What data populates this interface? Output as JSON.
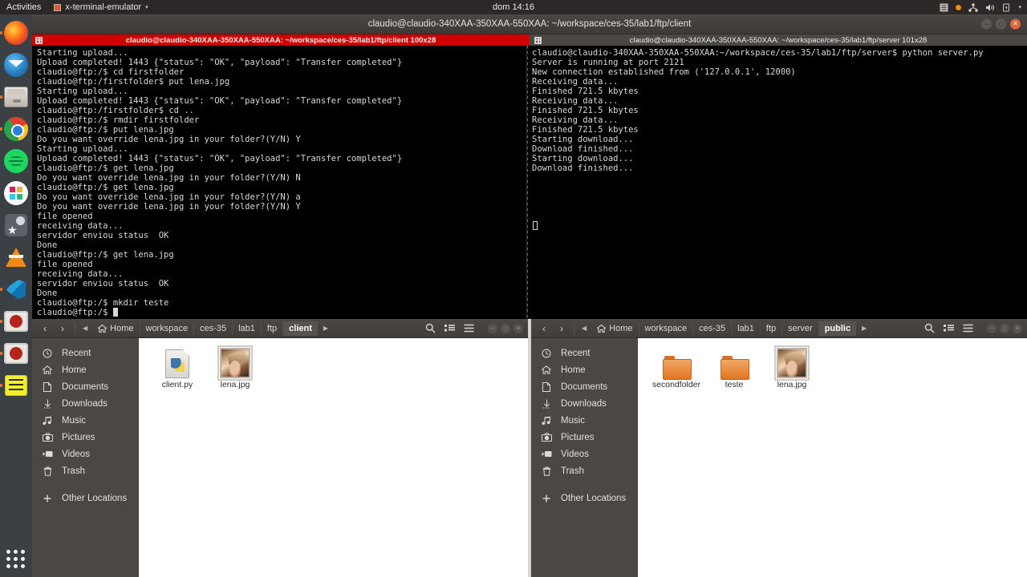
{
  "top_panel": {
    "activities": "Activities",
    "app_name": "x-terminal-emulator",
    "app_menu_arrow": "▾",
    "clock": "dom 14:16",
    "indicators": [
      "menu-icon",
      "notification-dot",
      "network-icon",
      "volume-icon",
      "battery-icon",
      "dropdown-arrow"
    ]
  },
  "launcher": {
    "items": [
      {
        "name": "firefox",
        "label": "Firefox",
        "running": true
      },
      {
        "name": "thunderbird",
        "label": "Thunderbird",
        "running": false
      },
      {
        "name": "files",
        "label": "Files",
        "running": true
      },
      {
        "name": "chrome",
        "label": "Google Chrome",
        "running": true
      },
      {
        "name": "spotify",
        "label": "Spotify",
        "running": false
      },
      {
        "name": "slack",
        "label": "Slack",
        "running": false
      },
      {
        "name": "software-center",
        "label": "Ubuntu Software",
        "running": false
      },
      {
        "name": "vlc",
        "label": "VLC Media Player",
        "running": false
      },
      {
        "name": "vscode",
        "label": "Visual Studio Code",
        "running": true
      },
      {
        "name": "terminal",
        "label": "Terminal",
        "running": true
      },
      {
        "name": "terminal-2",
        "label": "Terminal",
        "running": true
      },
      {
        "name": "notes",
        "label": "Notes",
        "running": true
      }
    ],
    "app_grid_label": "Show Applications"
  },
  "terminal_window": {
    "title": "claudio@claudio-340XAA-350XAA-550XAA: ~/workspace/ces-35/lab1/ftp/client",
    "window_controls": {
      "minimize": "—",
      "maximize": "□",
      "close": "×"
    },
    "tabs": [
      {
        "label": "claudio@claudio-340XAA-350XAA-550XAA: ~/workspace/ces-35/lab1/ftp/client 100x28",
        "active": true
      },
      {
        "label": "claudio@claudio-340XAA-350XAA-550XAA: ~/workspace/ces-35/lab1/ftp/server 101x28",
        "active": false
      }
    ],
    "left_pane": {
      "title": "ftp client session",
      "lines": [
        "Starting upload...",
        "Upload completed! 1443 {\"status\": \"OK\", \"payload\": \"Transfer completed\"}",
        "claudio@ftp:/$ cd firstfolder",
        "claudio@ftp:/firstfolder$ put lena.jpg",
        "Starting upload...",
        "Upload completed! 1443 {\"status\": \"OK\", \"payload\": \"Transfer completed\"}",
        "claudio@ftp:/firstfolder$ cd ..",
        "claudio@ftp:/$ rmdir firstfolder",
        "claudio@ftp:/$ put lena.jpg",
        "Do you want override lena.jpg in your folder?(Y/N) Y",
        "Starting upload...",
        "Upload completed! 1443 {\"status\": \"OK\", \"payload\": \"Transfer completed\"}",
        "claudio@ftp:/$ get lena.jpg",
        "Do you want override lena.jpg in your folder?(Y/N) N",
        "claudio@ftp:/$ get lena.jpg",
        "Do you want override lena.jpg in your folder?(Y/N) a",
        "Do you want override lena.jpg in your folder?(Y/N) Y",
        "file opened",
        "receiving data...",
        "servidor enviou status  OK",
        "Done",
        "claudio@ftp:/$ get lena.jpg",
        "file opened",
        "receiving data...",
        "servidor enviou status  OK",
        "Done",
        "claudio@ftp:/$ mkdir teste",
        "claudio@ftp:/$ "
      ]
    },
    "right_pane": {
      "title": "ftp server session",
      "lines": [
        "claudio@claudio-340XAA-350XAA-550XAA:~/workspace/ces-35/lab1/ftp/server$ python server.py",
        "Server is running at port 2121",
        "New connection established from ('127.0.0.1', 12000)",
        "Receiving data...",
        "Finished 721.5 kbytes",
        "Receiving data...",
        "Finished 721.5 kbytes",
        "Receiving data...",
        "Finished 721.5 kbytes",
        "Starting download...",
        "Download finished...",
        "Starting download...",
        "Download finished..."
      ]
    }
  },
  "file_manager_left": {
    "nav": {
      "back": "‹",
      "forward": "›"
    },
    "breadcrumbs": [
      {
        "label": "Home",
        "icon": "home-icon",
        "current": false
      },
      {
        "label": "workspace",
        "current": false
      },
      {
        "label": "ces-35",
        "current": false
      },
      {
        "label": "lab1",
        "current": false
      },
      {
        "label": "ftp",
        "current": false
      },
      {
        "label": "client",
        "current": true
      }
    ],
    "toolbar_icons": [
      "search-icon",
      "grid-view-icon",
      "hamburger-menu-icon"
    ],
    "window_controls": {
      "minimize": "—",
      "maximize": "□",
      "close": "×"
    },
    "sidebar": [
      {
        "label": "Recent",
        "icon": "clock-icon"
      },
      {
        "label": "Home",
        "icon": "home-icon"
      },
      {
        "label": "Documents",
        "icon": "document-icon"
      },
      {
        "label": "Downloads",
        "icon": "download-icon"
      },
      {
        "label": "Music",
        "icon": "music-icon"
      },
      {
        "label": "Pictures",
        "icon": "camera-icon"
      },
      {
        "label": "Videos",
        "icon": "video-icon"
      },
      {
        "label": "Trash",
        "icon": "trash-icon"
      },
      {
        "label": "Other Locations",
        "icon": "plus-icon"
      }
    ],
    "files": [
      {
        "name": "client.py",
        "type": "python-file",
        "selected": false
      },
      {
        "name": "lena.jpg",
        "type": "image-file",
        "selected": true
      }
    ]
  },
  "file_manager_right": {
    "nav": {
      "back": "‹",
      "forward": "›"
    },
    "breadcrumbs": [
      {
        "label": "Home",
        "icon": "home-icon",
        "current": false
      },
      {
        "label": "workspace",
        "current": false
      },
      {
        "label": "ces-35",
        "current": false
      },
      {
        "label": "lab1",
        "current": false
      },
      {
        "label": "ftp",
        "current": false
      },
      {
        "label": "server",
        "current": false
      },
      {
        "label": "public",
        "current": true
      }
    ],
    "toolbar_icons": [
      "search-icon",
      "grid-view-icon",
      "hamburger-menu-icon"
    ],
    "window_controls": {
      "minimize": "—",
      "maximize": "□",
      "close": "×"
    },
    "sidebar": [
      {
        "label": "Recent",
        "icon": "clock-icon"
      },
      {
        "label": "Home",
        "icon": "home-icon"
      },
      {
        "label": "Documents",
        "icon": "document-icon"
      },
      {
        "label": "Downloads",
        "icon": "download-icon"
      },
      {
        "label": "Music",
        "icon": "music-icon"
      },
      {
        "label": "Pictures",
        "icon": "camera-icon"
      },
      {
        "label": "Videos",
        "icon": "video-icon"
      },
      {
        "label": "Trash",
        "icon": "trash-icon"
      },
      {
        "label": "Other Locations",
        "icon": "plus-icon"
      }
    ],
    "files": [
      {
        "name": "secondfolder",
        "type": "folder",
        "selected": false
      },
      {
        "name": "teste",
        "type": "folder",
        "selected": false
      },
      {
        "name": "lena.jpg",
        "type": "image-file",
        "selected": true
      }
    ]
  },
  "colors": {
    "active_tab": "#cf0000",
    "panel": "#2c2828",
    "launcher": "#3b4044",
    "titlebar": "#443f3c",
    "terminal_bg": "#000000",
    "terminal_fg": "#d8d8d8",
    "accent_orange": "#e8702a"
  }
}
